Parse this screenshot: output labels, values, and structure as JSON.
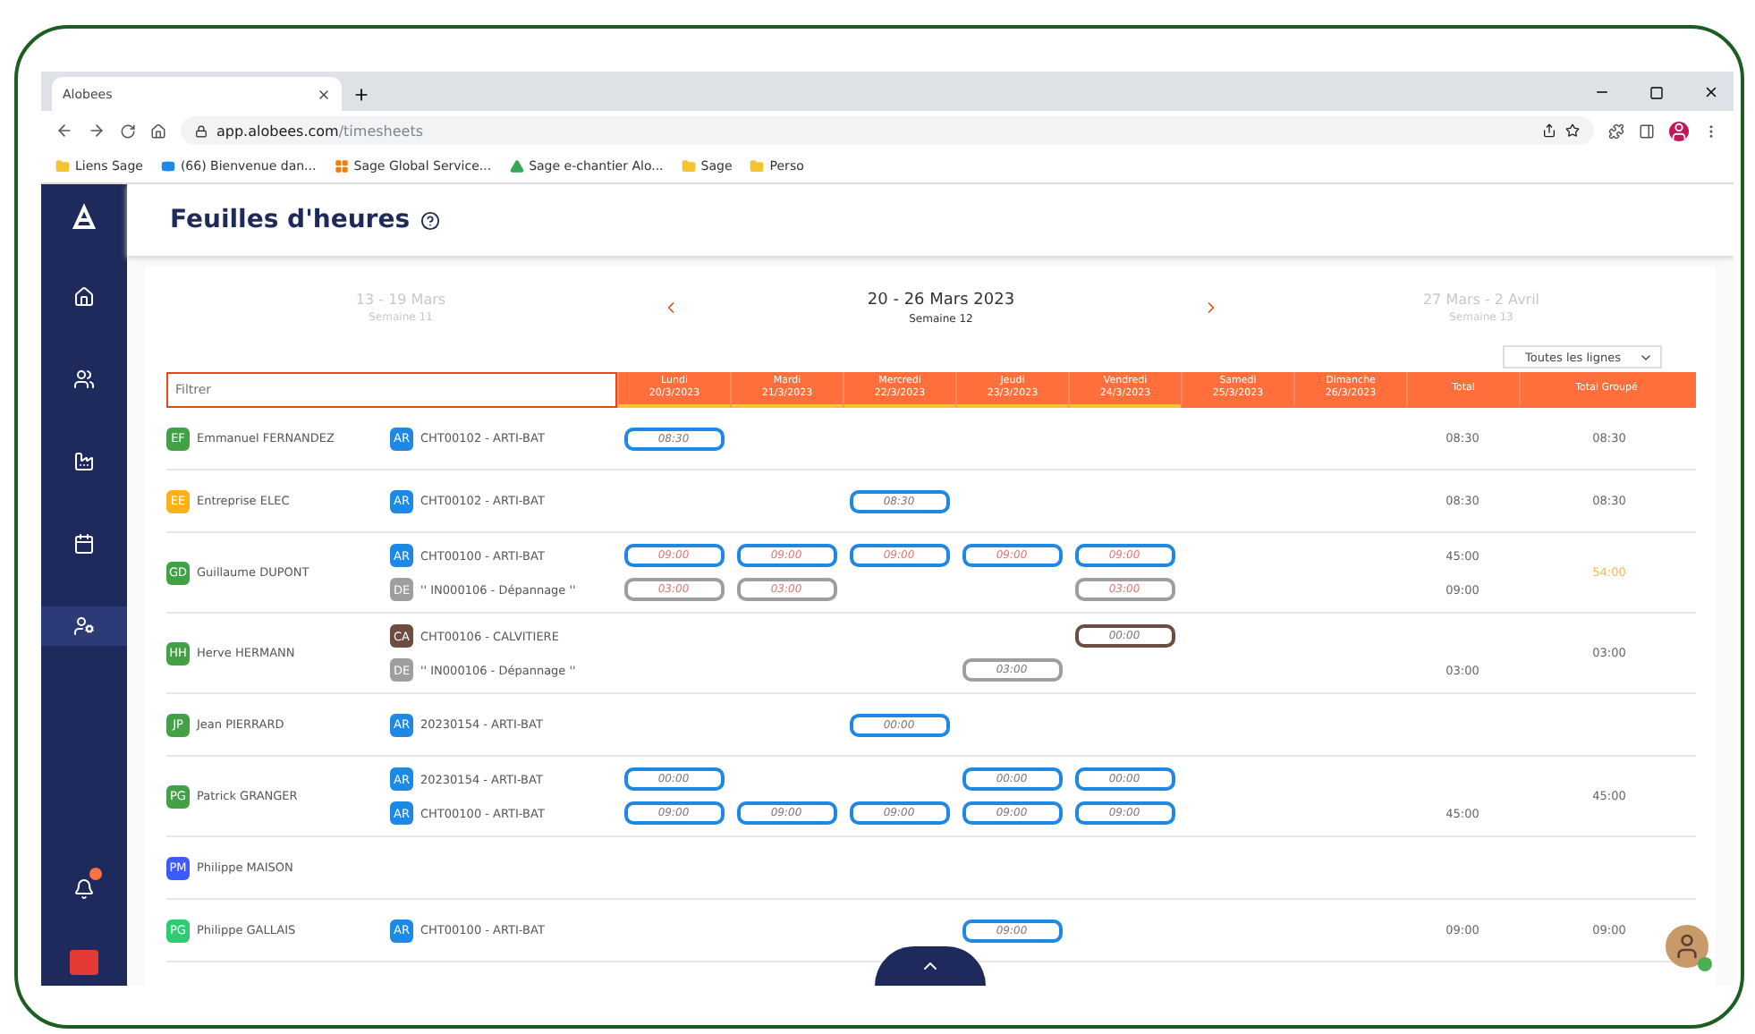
{
  "browser": {
    "tab_title": "Alobees",
    "url_host": "app.alobees.com",
    "url_path": "/timesheets",
    "bookmarks": [
      {
        "label": "Liens Sage",
        "kind": "folder"
      },
      {
        "label": "(66) Bienvenue dan...",
        "kind": "video"
      },
      {
        "label": "Sage Global Service...",
        "kind": "grid"
      },
      {
        "label": "Sage e-chantier Alo...",
        "kind": "drive"
      },
      {
        "label": "Sage",
        "kind": "folder"
      },
      {
        "label": "Perso",
        "kind": "folder"
      }
    ]
  },
  "sidebar": {
    "items": [
      {
        "kind": "home",
        "selected": false
      },
      {
        "kind": "team",
        "selected": false
      },
      {
        "kind": "chart",
        "selected": false
      },
      {
        "kind": "calendar",
        "selected": false
      },
      {
        "kind": "user",
        "selected": true
      }
    ],
    "notifications": true
  },
  "page": {
    "title": "Feuilles d'heures"
  },
  "weeks": [
    {
      "range": "13 - 19 Mars",
      "label": "Semaine 11",
      "selected": false
    },
    {
      "range": "20 - 26 Mars 2023",
      "label": "Semaine 12",
      "selected": true
    },
    {
      "range": "27 Mars - 2 Avril",
      "label": "Semaine 13",
      "selected": false
    }
  ],
  "line_filter": "Toutes les lignes",
  "filter": {
    "placeholder": "Filtrer"
  },
  "days": [
    {
      "name": "Lundi",
      "date": "20/3/2023",
      "flagged": true
    },
    {
      "name": "Mardi",
      "date": "21/3/2023",
      "flagged": true
    },
    {
      "name": "Mercredi",
      "date": "22/3/2023",
      "flagged": true
    },
    {
      "name": "Jeudi",
      "date": "23/3/2023",
      "flagged": true
    },
    {
      "name": "Vendredi",
      "date": "24/3/2023",
      "flagged": true
    },
    {
      "name": "Samedi",
      "date": "25/3/2023",
      "flagged": false
    },
    {
      "name": "Dimanche",
      "date": "26/3/2023",
      "flagged": false
    }
  ],
  "total_columns": [
    "Total",
    "Total Groupé"
  ],
  "people": [
    {
      "initials": "EF",
      "name": "Emmanuel FERNANDEZ",
      "color": "#43a047",
      "group_total": "08:30",
      "group_alert": false,
      "lines": [
        {
          "badge": "AR",
          "color": "#1e88e5",
          "project": "CHT00102 - ARTI-BAT",
          "total": "08:30",
          "cells": [
            {
              "value": "08:30",
              "alert": false
            },
            null,
            null,
            null,
            null,
            null,
            null
          ]
        }
      ]
    },
    {
      "initials": "EE",
      "name": "Entreprise ELEC",
      "color": "#fbb117",
      "group_total": "08:30",
      "group_alert": false,
      "lines": [
        {
          "badge": "AR",
          "color": "#1e88e5",
          "project": "CHT00102 - ARTI-BAT",
          "total": "08:30",
          "cells": [
            null,
            null,
            {
              "value": "08:30",
              "alert": false
            },
            null,
            null,
            null,
            null
          ]
        }
      ]
    },
    {
      "initials": "GD",
      "name": "Guillaume DUPONT",
      "color": "#43a047",
      "group_total": "54:00",
      "group_alert": true,
      "lines": [
        {
          "badge": "AR",
          "color": "#1e88e5",
          "project": "CHT00100 - ARTI-BAT",
          "total": "45:00",
          "cells": [
            {
              "value": "09:00",
              "alert": true
            },
            {
              "value": "09:00",
              "alert": true
            },
            {
              "value": "09:00",
              "alert": true
            },
            {
              "value": "09:00",
              "alert": true
            },
            {
              "value": "09:00",
              "alert": true
            },
            null,
            null
          ]
        },
        {
          "badge": "DE",
          "color": "#9e9e9e",
          "project": "'' IN000106 - Dépannage ''",
          "total": "09:00",
          "cells": [
            {
              "value": "03:00",
              "alert": true
            },
            {
              "value": "03:00",
              "alert": true
            },
            null,
            null,
            {
              "value": "03:00",
              "alert": true
            },
            null,
            null
          ]
        }
      ]
    },
    {
      "initials": "HH",
      "name": "Herve HERMANN",
      "color": "#43a047",
      "group_total": "03:00",
      "group_alert": false,
      "lines": [
        {
          "badge": "CA",
          "color": "#6d4c41",
          "project": "CHT00106 - CALVITIERE",
          "cells": [
            null,
            null,
            null,
            null,
            {
              "value": "00:00",
              "alert": false
            },
            null,
            null
          ]
        },
        {
          "badge": "DE",
          "color": "#9e9e9e",
          "project": "'' IN000106 - Dépannage ''",
          "total": "03:00",
          "cells": [
            null,
            null,
            null,
            {
              "value": "03:00",
              "alert": false
            },
            null,
            null,
            null
          ]
        }
      ]
    },
    {
      "initials": "JP",
      "name": "Jean PIERRARD",
      "color": "#43a047",
      "lines": [
        {
          "badge": "AR",
          "color": "#1e88e5",
          "project": "20230154 - ARTI-BAT",
          "cells": [
            null,
            null,
            {
              "value": "00:00",
              "alert": false
            },
            null,
            null,
            null,
            null
          ]
        }
      ]
    },
    {
      "initials": "PG",
      "name": "Patrick GRANGER",
      "color": "#43a047",
      "group_total": "45:00",
      "group_alert": false,
      "lines": [
        {
          "badge": "AR",
          "color": "#1e88e5",
          "project": "20230154 - ARTI-BAT",
          "cells": [
            {
              "value": "00:00",
              "alert": false
            },
            null,
            null,
            {
              "value": "00:00",
              "alert": false
            },
            {
              "value": "00:00",
              "alert": false
            },
            null,
            null
          ]
        },
        {
          "badge": "AR",
          "color": "#1e88e5",
          "project": "CHT00100 - ARTI-BAT",
          "total": "45:00",
          "cells": [
            {
              "value": "09:00",
              "alert": false
            },
            {
              "value": "09:00",
              "alert": false
            },
            {
              "value": "09:00",
              "alert": false
            },
            {
              "value": "09:00",
              "alert": false
            },
            {
              "value": "09:00",
              "alert": false
            },
            null,
            null
          ]
        }
      ]
    },
    {
      "initials": "PM",
      "name": "Philippe MAISON",
      "color": "#3d5afe"
    },
    {
      "initials": "PG",
      "name": "Philippe GALLAIS",
      "color": "#2ecc71",
      "group_total": "09:00",
      "group_alert": false,
      "lines": [
        {
          "badge": "AR",
          "color": "#1e88e5",
          "project": "CHT00100 - ARTI-BAT",
          "total": "09:00",
          "cells": [
            null,
            null,
            null,
            {
              "value": "09:00",
              "alert": false
            },
            null,
            null,
            null
          ]
        }
      ]
    }
  ]
}
